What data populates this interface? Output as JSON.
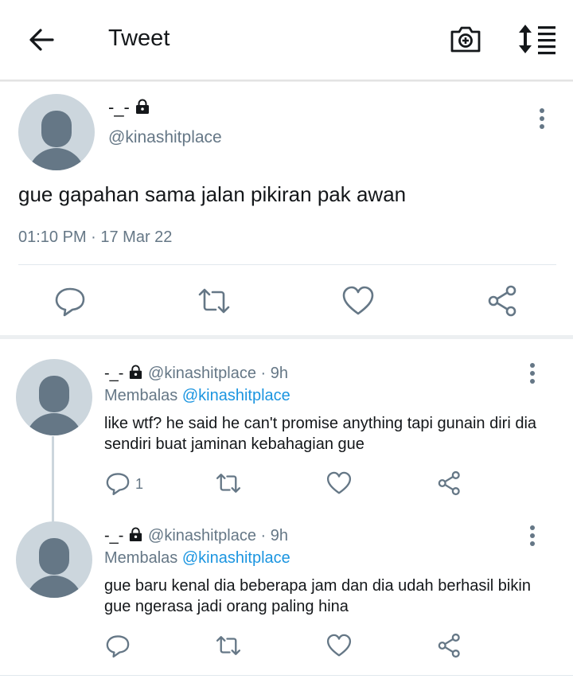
{
  "header": {
    "title": "Tweet",
    "back_icon": "arrow-left-icon",
    "camera_icon": "camera-plus-icon",
    "sort_icon": "sort-icon"
  },
  "main_tweet": {
    "name": "-_-",
    "handle": "@kinashitplace",
    "text": "gue gapahan sama jalan pikiran pak awan",
    "timestamp": "01:10 PM · 17 Mar 22",
    "actions": [
      "reply-icon",
      "retweet-icon",
      "like-icon",
      "share-icon"
    ]
  },
  "replies": [
    {
      "name": "-_-",
      "handle": "@kinashitplace",
      "age": "· 9h",
      "replying_prefix": "Membalas",
      "replying_to": "@kinashitplace",
      "text": "like wtf? he said he can't promise anything tapi gunain diri dia sendiri buat jaminan kebahagian gue",
      "reply_count": "1"
    },
    {
      "name": "-_-",
      "handle": "@kinashitplace",
      "age": "· 9h",
      "replying_prefix": "Membalas",
      "replying_to": "@kinashitplace",
      "text": "gue baru kenal dia beberapa jam dan dia udah berhasil bikin gue ngerasa jadi orang paling hina",
      "reply_count": ""
    }
  ],
  "colors": {
    "text": "#14171a",
    "muted": "#657786",
    "mention": "#1b95e0",
    "avatar_bg": "#ccd6dd",
    "avatar_fg": "#657786"
  }
}
